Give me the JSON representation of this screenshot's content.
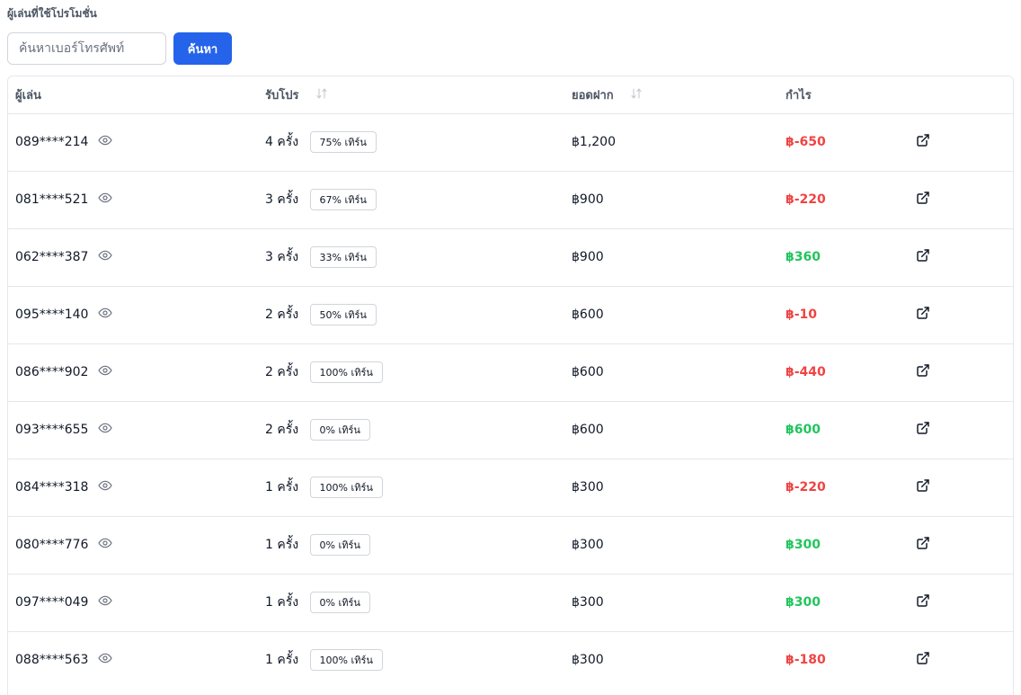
{
  "section_title": "ผู้เล่นที่ใช้โปรโมชั่น",
  "search": {
    "placeholder": "ค้นหาเบอร์โทรศัพท์",
    "value": "",
    "button_label": "ค้นหา"
  },
  "table": {
    "headers": {
      "player": "ผู้เล่น",
      "promos": "รับโปร",
      "deposit": "ยอดฝาก",
      "profit": "กำไร"
    },
    "rows": [
      {
        "phone": "089****214",
        "times": "4 ครั้ง",
        "badge": "75% เทิร์น",
        "deposit": "฿1,200",
        "profit": "฿-650",
        "profit_sign": "neg"
      },
      {
        "phone": "081****521",
        "times": "3 ครั้ง",
        "badge": "67% เทิร์น",
        "deposit": "฿900",
        "profit": "฿-220",
        "profit_sign": "neg"
      },
      {
        "phone": "062****387",
        "times": "3 ครั้ง",
        "badge": "33% เทิร์น",
        "deposit": "฿900",
        "profit": "฿360",
        "profit_sign": "pos"
      },
      {
        "phone": "095****140",
        "times": "2 ครั้ง",
        "badge": "50% เทิร์น",
        "deposit": "฿600",
        "profit": "฿-10",
        "profit_sign": "neg"
      },
      {
        "phone": "086****902",
        "times": "2 ครั้ง",
        "badge": "100% เทิร์น",
        "deposit": "฿600",
        "profit": "฿-440",
        "profit_sign": "neg"
      },
      {
        "phone": "093****655",
        "times": "2 ครั้ง",
        "badge": "0% เทิร์น",
        "deposit": "฿600",
        "profit": "฿600",
        "profit_sign": "pos"
      },
      {
        "phone": "084****318",
        "times": "1 ครั้ง",
        "badge": "100% เทิร์น",
        "deposit": "฿300",
        "profit": "฿-220",
        "profit_sign": "neg"
      },
      {
        "phone": "080****776",
        "times": "1 ครั้ง",
        "badge": "0% เทิร์น",
        "deposit": "฿300",
        "profit": "฿300",
        "profit_sign": "pos"
      },
      {
        "phone": "097****049",
        "times": "1 ครั้ง",
        "badge": "0% เทิร์น",
        "deposit": "฿300",
        "profit": "฿300",
        "profit_sign": "pos"
      },
      {
        "phone": "088****563",
        "times": "1 ครั้ง",
        "badge": "100% เทิร์น",
        "deposit": "฿300",
        "profit": "฿-180",
        "profit_sign": "neg"
      }
    ]
  },
  "icons": {
    "reveal": "eye-icon",
    "open": "external-link-icon",
    "sort": "sort-arrows-icon"
  },
  "colors": {
    "primary": "#2563eb",
    "negative": "#ef4444",
    "positive": "#22c55e"
  }
}
